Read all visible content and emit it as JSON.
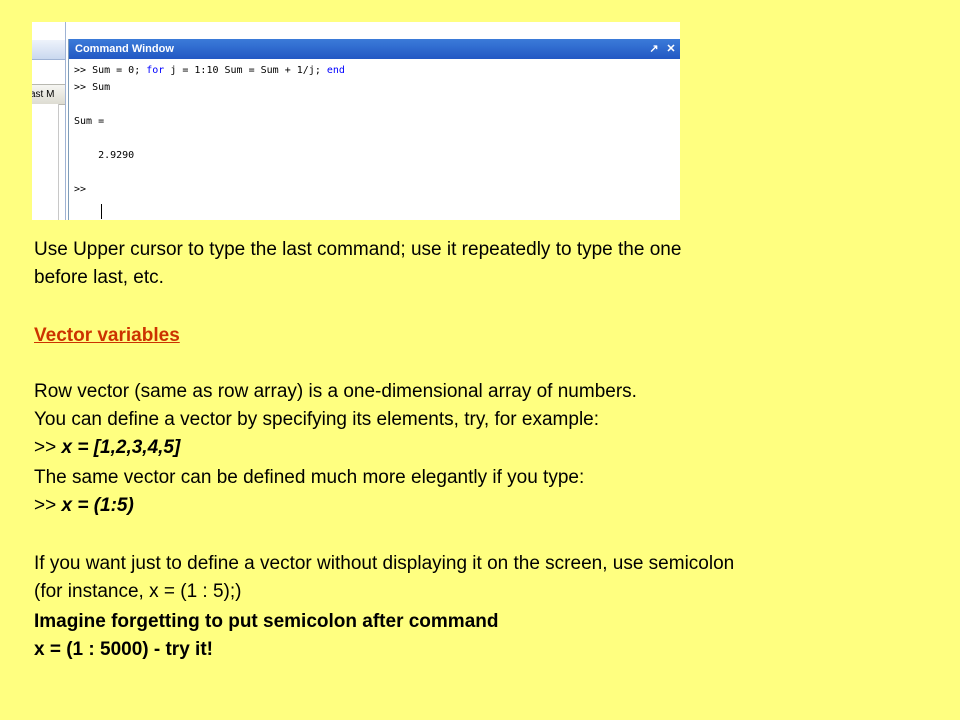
{
  "screenshot": {
    "left_tab_label": "ast M",
    "title": "Command Window",
    "title_buttons": [
      "↗",
      "✕"
    ],
    "lines": [
      {
        "prompt": ">> ",
        "parts": [
          {
            "text": "Sum = 0; ",
            "kw": false
          },
          {
            "text": "for",
            "kw": true
          },
          {
            "text": " j = 1:10 Sum = Sum + 1/j; ",
            "kw": false
          },
          {
            "text": "end",
            "kw": true
          }
        ]
      },
      {
        "prompt": ">> ",
        "parts": [
          {
            "text": "Sum",
            "kw": false
          }
        ]
      },
      {
        "prompt": "",
        "parts": [
          {
            "text": "Sum =",
            "kw": false
          }
        ]
      },
      {
        "prompt": "",
        "parts": [
          {
            "text": "    2.9290",
            "kw": false
          }
        ]
      },
      {
        "prompt": ">> ",
        "parts": [
          {
            "text": "",
            "kw": false
          }
        ]
      }
    ]
  },
  "content": {
    "instruction_line1": "Use Upper cursor to type the last command; use it repeatedly to type the one",
    "instruction_line2": "before last, etc.",
    "heading": "Vector variables",
    "row_vector_def": "Row vector (same as row array) is a one-dimensional array of numbers.",
    "define_example": "You can define a vector by specifying its elements, try, for example:",
    "prompt1": ">> ",
    "example1": "x = [1,2,3,4,5]",
    "elegant_line": "The same vector can be defined much more elegantly if you type:",
    "prompt2": ">> ",
    "example2": "x = (1:5)",
    "semicolon_line1": "If you want just to define a vector without displaying it on the screen, use semicolon",
    "semicolon_line2": "(for instance, x = (1 : 5);)",
    "imagine_line": "Imagine forgetting to put semicolon after command",
    "try_line": "x = (1 : 5000) - try it!"
  }
}
